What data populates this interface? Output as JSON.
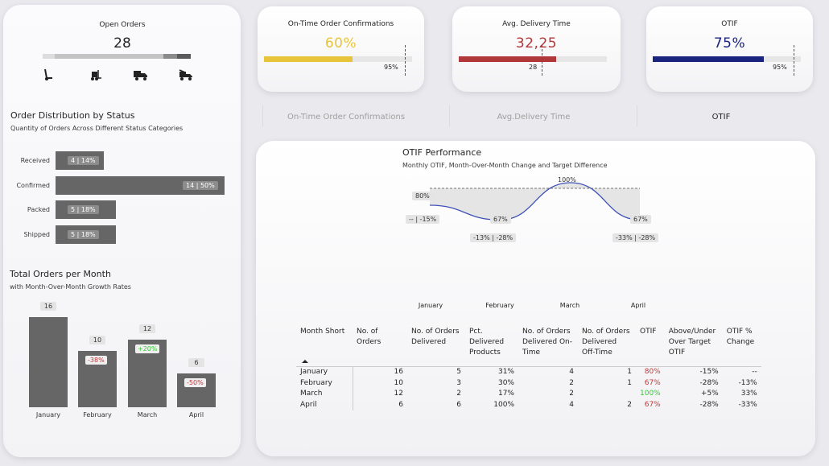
{
  "open_orders": {
    "title": "Open Orders",
    "value": "28",
    "icons": [
      "hand-truck-icon",
      "forklift-icon",
      "delivery-truck-icon",
      "tow-truck-icon"
    ]
  },
  "status_distribution": {
    "title": "Order Distribution by Status",
    "subtitle": "Quantity of Orders Across Different Status Categories",
    "rows": [
      {
        "label": "Received",
        "value": 4,
        "pct": "4 | 14%"
      },
      {
        "label": "Confirmed",
        "value": 14,
        "pct": "14 | 50%"
      },
      {
        "label": "Packed",
        "value": 5,
        "pct": "5 | 18%"
      },
      {
        "label": "Shipped",
        "value": 5,
        "pct": "5 | 18%"
      }
    ]
  },
  "monthly_orders": {
    "title": "Total Orders per Month",
    "subtitle": "with Month-Over-Month Growth Rates",
    "months": [
      "January",
      "February",
      "March",
      "April"
    ],
    "values": [
      16,
      10,
      12,
      6
    ],
    "value_labels": [
      "16",
      "10",
      "12",
      "6"
    ],
    "growth": [
      "",
      "-38%",
      "+20%",
      "-50%"
    ]
  },
  "kpis": [
    {
      "title": "On-Time Order Confirmations",
      "value": "60%",
      "target": "95%",
      "progress": 0.6,
      "target_frac": 0.95,
      "color": "#e8c43a"
    },
    {
      "title": "Avg. Delivery Time",
      "value": "32,25",
      "target": "28",
      "progress": 0.66,
      "target_frac": 0.56,
      "color": "#b0373a"
    },
    {
      "title": "OTIF",
      "value": "75%",
      "target": "95%",
      "progress": 0.75,
      "target_frac": 0.95,
      "color": "#1a237e"
    }
  ],
  "tabs": [
    "On-Time Order Confirmations",
    "Avg.Delivery Time",
    "OTIF"
  ],
  "otif_chart": {
    "title": "OTIF Performance",
    "subtitle": "Monthly OTIF, Month-Over-Month Change and Target Difference",
    "months": [
      "January",
      "February",
      "March",
      "April"
    ],
    "values": [
      80,
      67,
      100,
      67
    ],
    "value_labels": [
      "80%",
      "67%",
      "100%",
      "67%"
    ],
    "change_labels": [
      "-- | -15%",
      "-13% | -28%",
      "",
      "-33% | -28%"
    ],
    "target": 95
  },
  "table": {
    "columns": [
      "Month Short",
      "No. of Orders",
      "No. of Orders Delivered",
      "Pct. Delivered Products",
      "No. of Orders Delivered On-Time",
      "No. of Orders Delivered Off-Time",
      "OTIF",
      "Above/Under Over Target OTIF",
      "OTIF % Change"
    ],
    "rows": [
      [
        "January",
        "16",
        "5",
        "31%",
        "4",
        "1",
        "80%",
        "-15%",
        "--"
      ],
      [
        "February",
        "10",
        "3",
        "30%",
        "2",
        "1",
        "67%",
        "-28%",
        "-13%"
      ],
      [
        "March",
        "12",
        "2",
        "17%",
        "2",
        "",
        "100%",
        "+5%",
        "33%"
      ],
      [
        "April",
        "6",
        "6",
        "100%",
        "4",
        "2",
        "67%",
        "-28%",
        "-33%"
      ]
    ],
    "otif_colors": [
      "red",
      "red",
      "green",
      "red"
    ]
  },
  "colors": {
    "bar": "#666666",
    "otif_line": "#3f51b5",
    "accent_yellow": "#e8c43a",
    "accent_red": "#b0373a",
    "accent_navy": "#1a237e"
  }
}
